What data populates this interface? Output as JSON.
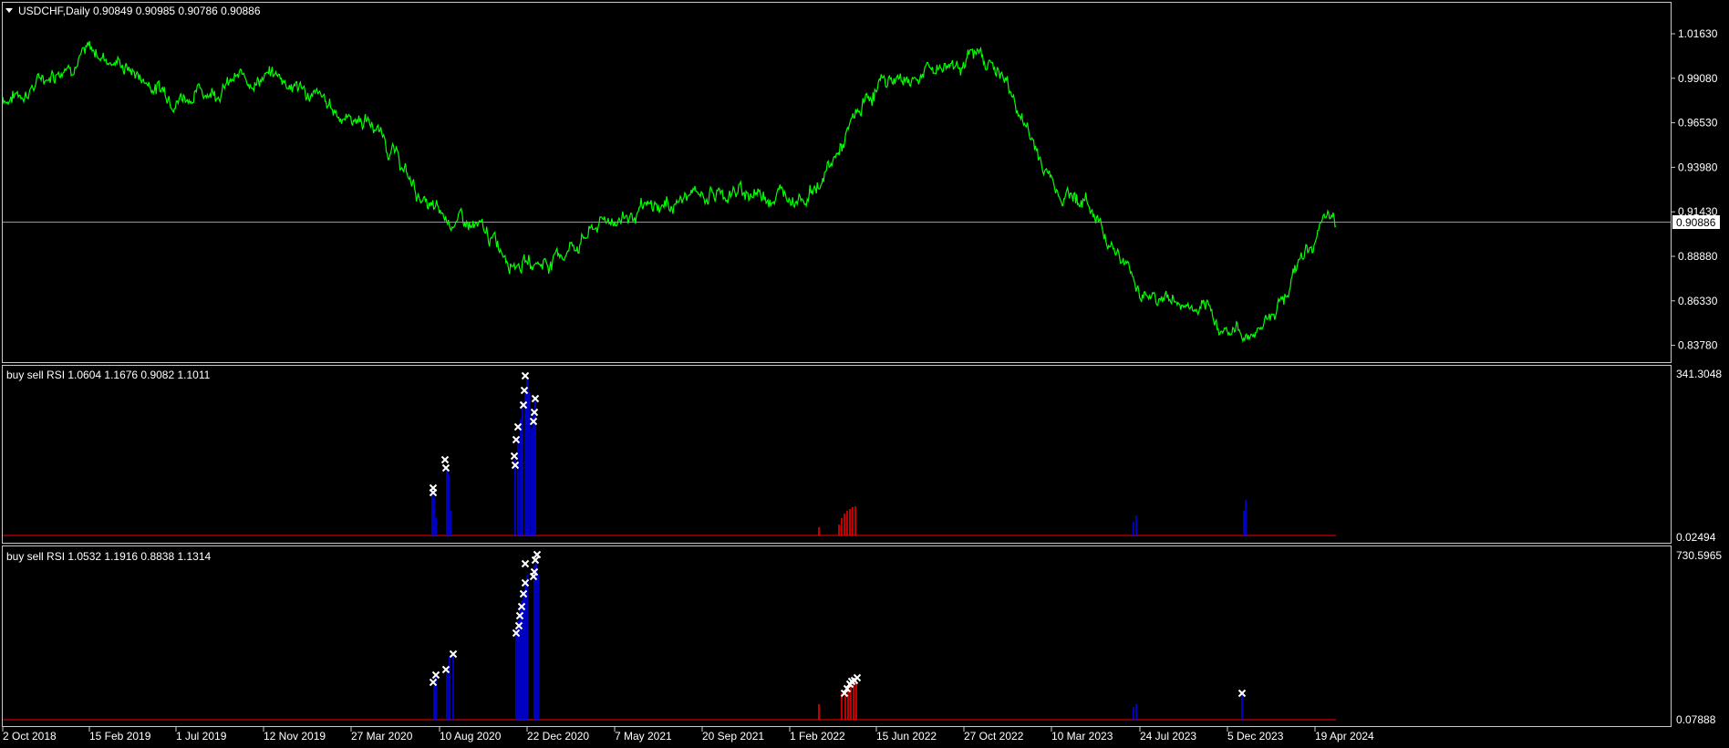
{
  "main_panel": {
    "symbol_info": "USDCHF,Daily  0.90849 0.90985 0.90786 0.90886",
    "price_labels": [
      "1.01630",
      "0.99080",
      "0.96530",
      "0.93980",
      "0.91430",
      "0.88880",
      "0.86330",
      "0.83780"
    ],
    "current_price": "0.90886",
    "line_color": "#00ff00",
    "current_line_color": "#8899aa"
  },
  "indicator1": {
    "label": "buy sell RSI 1.0604 1.1676 0.9082 1.1011",
    "scale_top": "341.3048",
    "scale_bottom": "0.02494",
    "buy_color": "#0000ff",
    "sell_color": "#ff0000",
    "marker_color": "#ffffff"
  },
  "indicator2": {
    "label": "buy sell RSI 1.0532 1.1916 0.8838 1.1314",
    "scale_top": "730.5965",
    "scale_bottom": "0.07888"
  },
  "time_axis": {
    "labels": [
      "2 Oct 2018",
      "15 Feb 2019",
      "1 Jul 2019",
      "12 Nov 2019",
      "27 Mar 2020",
      "10 Aug 2020",
      "22 Dec 2020",
      "7 May 2021",
      "20 Sep 2021",
      "1 Feb 2022",
      "15 Jun 2022",
      "27 Oct 2022",
      "10 Mar 2023",
      "24 Jul 2023",
      "5 Dec 2023",
      "19 Apr 2024"
    ]
  },
  "chart_data": {
    "type": "line",
    "series": [
      {
        "values": [
          {
            "x": "2 Oct 2018",
            "y": 0.98
          },
          {
            "x": "15 Feb 2019",
            "y": 1.005
          },
          {
            "x": "1 Jul 2019",
            "y": 0.982
          },
          {
            "x": "12 Nov 2019",
            "y": 0.992
          },
          {
            "x": "27 Mar 2020",
            "y": 0.968
          },
          {
            "x": "10 Aug 2020",
            "y": 0.91
          },
          {
            "x": "22 Dec 2020",
            "y": 0.885
          },
          {
            "x": "7 May 2021",
            "y": 0.912
          },
          {
            "x": "20 Sep 2021",
            "y": 0.925
          },
          {
            "x": "1 Feb 2022",
            "y": 0.925
          },
          {
            "x": "15 Jun 2022",
            "y": 0.99
          },
          {
            "x": "27 Oct 2022",
            "y": 1.003
          },
          {
            "x": "10 Mar 2023",
            "y": 0.925
          },
          {
            "x": "24 Jul 2023",
            "y": 0.865
          },
          {
            "x": "5 Dec 2023",
            "y": 0.845
          },
          {
            "x": "19 Apr 2024",
            "y": 0.908
          }
        ]
      }
    ]
  }
}
